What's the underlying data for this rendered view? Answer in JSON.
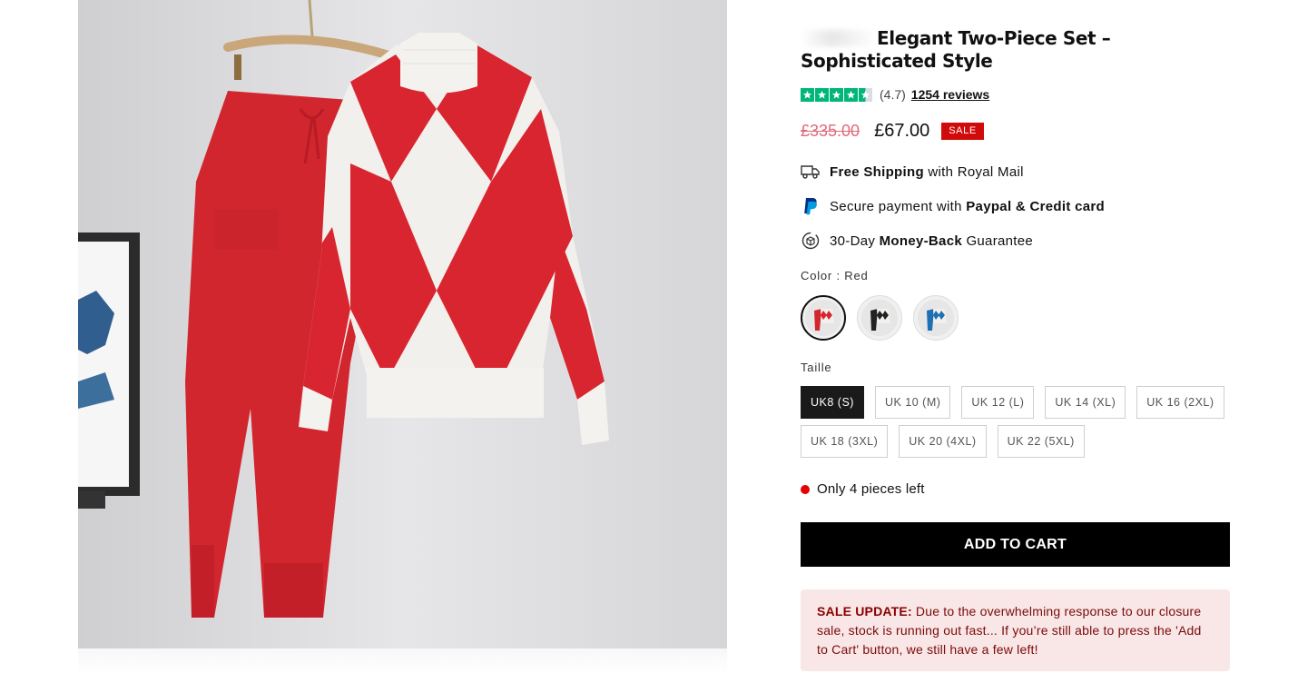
{
  "product": {
    "title": "Elegant Two-Piece Set – Sophisticated Style",
    "rating": "(4.7)",
    "reviews": "1254 reviews",
    "old_price": "£335.00",
    "new_price": "£67.00",
    "sale_badge": "SALE"
  },
  "features": [
    {
      "icon": "truck-icon",
      "bold": "Free Shipping",
      "text": " with Royal Mail"
    },
    {
      "icon": "paypal-icon",
      "text": "Secure payment with ",
      "bold": "Paypal & Credit card"
    },
    {
      "icon": "money-back-icon",
      "text": "30-Day ",
      "bold": "Money-Back",
      "text2": " Guarantee"
    }
  ],
  "color": {
    "label": "Color : Red",
    "options": [
      "Red",
      "Black",
      "Blue"
    ],
    "selected": "Red"
  },
  "size": {
    "label": "Taille",
    "options": [
      "UK8 (S)",
      "UK 10 (M)",
      "UK 12 (L)",
      "UK 14 (XL)",
      "UK 16 (2XL)",
      "UK 18 (3XL)",
      "UK 20 (4XL)",
      "UK 22 (5XL)"
    ],
    "selected": "UK8 (S)"
  },
  "stock_text": "Only 4 pieces left",
  "add_to_cart": "ADD TO CART",
  "sale_update": {
    "heading": "SALE UPDATE:",
    "text": " Due to the overwhelming response to our closure sale, stock is running out fast... If you’re still able to press the 'Add to Cart' button, we still have a few left!"
  },
  "colors": {
    "accent_red": "#d10a0a",
    "rating_green": "#00b67a",
    "old_price": "#e26a7a",
    "stock_dot": "#e60000",
    "notice_bg": "#f9e6e6"
  }
}
